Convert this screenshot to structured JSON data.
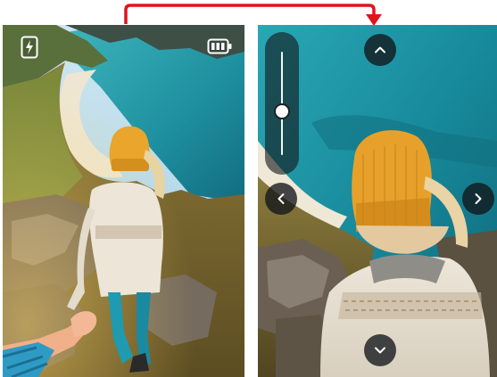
{
  "left_view": {
    "photo": "hiker-on-cliff-coastline",
    "icons": {
      "flash": "flash-icon",
      "battery": "battery-icon"
    }
  },
  "right_view": {
    "photo": "hiker-on-cliff-coastline-zoomed",
    "zoom_slider": {
      "level": 0.42
    },
    "controls": {
      "up": "chevron-up-icon",
      "down": "chevron-down-icon",
      "left": "chevron-left-icon",
      "right": "chevron-right-icon"
    }
  },
  "colors": {
    "connector_arrow": "#e0141b",
    "control_background": "#14181c",
    "icon_foreground": "#ffffff"
  }
}
